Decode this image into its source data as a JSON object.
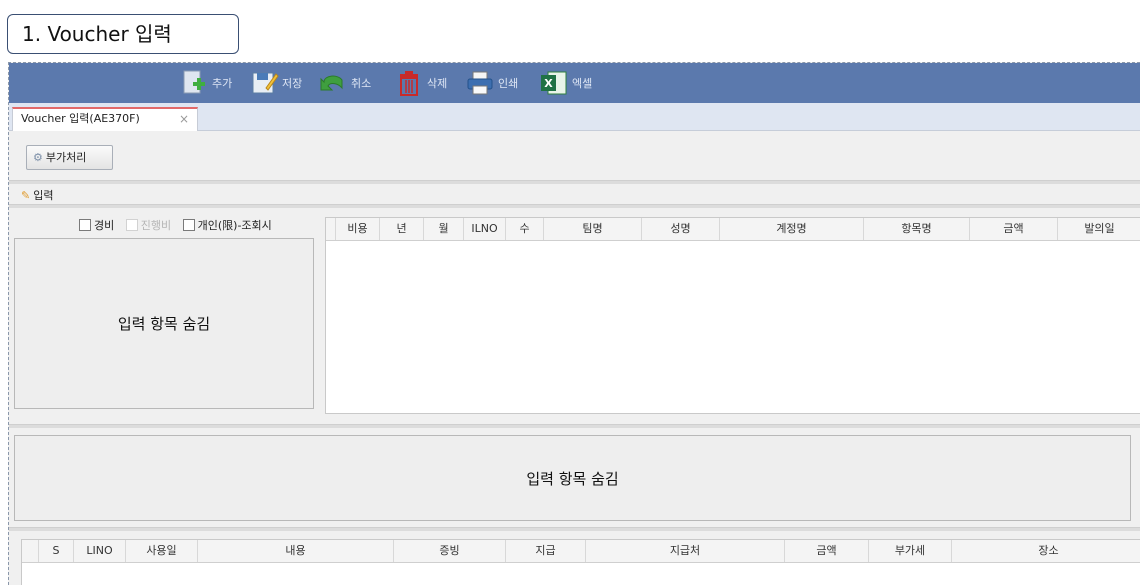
{
  "section_caption": "1. Voucher 입력",
  "toolbar": {
    "buttons": [
      {
        "label": "추가",
        "icon": "add-document-icon"
      },
      {
        "label": "저장",
        "icon": "save-icon"
      },
      {
        "label": "취소",
        "icon": "undo-arrow-icon"
      },
      {
        "label": "삭제",
        "icon": "trash-icon"
      },
      {
        "label": "인쇄",
        "icon": "printer-icon"
      },
      {
        "label": "엑셀",
        "icon": "excel-icon"
      }
    ]
  },
  "tab": {
    "label": "Voucher 입력(AE370F)",
    "close": "×"
  },
  "extra_button_label": "부가처리",
  "input_section_label": "입력",
  "checkboxes": [
    {
      "label": "경비",
      "checked": false,
      "disabled": false
    },
    {
      "label": "진행비",
      "checked": false,
      "disabled": true
    },
    {
      "label": "개인(限)-조회시",
      "checked": false,
      "disabled": false
    }
  ],
  "left_panel_text": "입력 항목 숨김",
  "middle_panel_text": "입력 항목 숨김",
  "top_grid": {
    "columns": [
      "비용",
      "년",
      "월",
      "ILNO",
      "수",
      "팀명",
      "성명",
      "계정명",
      "항목명",
      "금액",
      "발의일"
    ]
  },
  "bottom_grid": {
    "columns": [
      "",
      "S",
      "LINO",
      "사용일",
      "내용",
      "증빙",
      "지급",
      "지급처",
      "금액",
      "부가세",
      "장소"
    ]
  },
  "colors": {
    "toolbar_bg": "#5b79ad",
    "tab_accent": "#e26a6a",
    "caption_border": "#3a4f73"
  }
}
